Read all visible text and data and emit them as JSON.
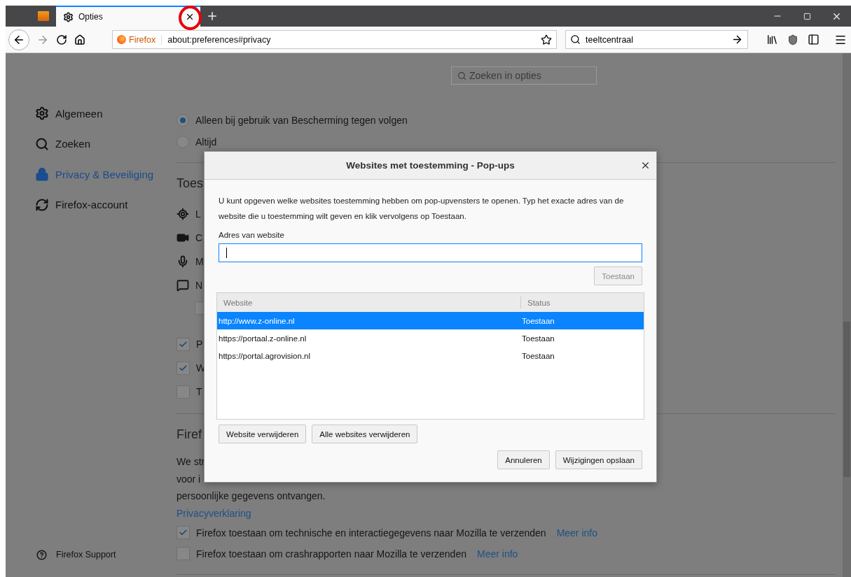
{
  "tabs": [
    {
      "kind": "pinned",
      "selected": false
    },
    {
      "kind": "page",
      "label": "Opties",
      "selected": true
    }
  ],
  "toolbar": {
    "identity": "Firefox",
    "url": "about:preferences#privacy",
    "search": "teeltcentraal"
  },
  "options_search": {
    "placeholder": "Zoeken in opties"
  },
  "sidebar": {
    "items": [
      {
        "kind": "general",
        "label": "Algemeen",
        "selected": false
      },
      {
        "kind": "search",
        "label": "Zoeken",
        "selected": false
      },
      {
        "kind": "privacy",
        "label": "Privacy & Beveiliging",
        "selected": true
      },
      {
        "kind": "sync",
        "label": "Firefox-account",
        "selected": false
      }
    ],
    "support": "Firefox Support"
  },
  "content": [
    {
      "kind": "radio",
      "label": "Alleen bij gebruik van Bescherming tegen volgen",
      "selected": true
    },
    {
      "kind": "radio",
      "label": "Altijd",
      "selected": false
    },
    {
      "kind": "divider"
    },
    {
      "kind": "heading",
      "label": "Toes"
    },
    {
      "kind": "location",
      "label": "L"
    },
    {
      "kind": "camera",
      "label": "C"
    },
    {
      "kind": "mic",
      "label": "M"
    },
    {
      "kind": "notification",
      "label": "N"
    },
    {
      "kind": "subcheck",
      "checked": false
    },
    {
      "kind": "check",
      "label": "P",
      "checked": true
    },
    {
      "kind": "check",
      "label": "W",
      "checked": true
    },
    {
      "kind": "check",
      "label": "T",
      "checked": false
    },
    {
      "kind": "divider"
    },
    {
      "kind": "heading",
      "label": "Firef"
    },
    {
      "kind": "text",
      "label": "We str"
    },
    {
      "kind": "text",
      "label": "voor i"
    },
    {
      "kind": "text",
      "label": "persoonlijke gegevens ontvangen."
    },
    {
      "kind": "link",
      "label": "Privacyverklaring"
    },
    {
      "kind": "check",
      "label": "Firefox toestaan om technische en interactiegegevens naar Mozilla te verzenden",
      "checked": true,
      "link": "Meer info"
    },
    {
      "kind": "check",
      "label": "Firefox toestaan om crashrapporten naar Mozilla te verzenden",
      "checked": false,
      "link": "Meer info"
    },
    {
      "kind": "divider"
    }
  ],
  "dialog": {
    "title": "Websites met toestemming - Pop-ups",
    "description": "U kunt opgeven welke websites toestemming hebben om pop-upvensters te openen. Typ het exacte adres van de website die u toestemming wilt geven en klik vervolgens op Toestaan.",
    "address_label": "Adres van website",
    "allow_button": {
      "label": "Toestaan",
      "disabled": true
    },
    "columns": [
      "Website",
      "Status"
    ],
    "rows": [
      {
        "website": "http://www.z-online.nl",
        "status": "Toestaan",
        "selected": true
      },
      {
        "website": "https://portaal.z-online.nl",
        "status": "Toestaan",
        "selected": false
      },
      {
        "website": "https://portal.agrovision.nl",
        "status": "Toestaan",
        "selected": false
      }
    ],
    "list_buttons": [
      "Website verwijderen",
      "Alle websites verwijderen"
    ],
    "footer_buttons": [
      "Annuleren",
      "Wijzigingen opslaan"
    ]
  },
  "annotation": {
    "kind": "circle",
    "color": "#e8000b"
  }
}
